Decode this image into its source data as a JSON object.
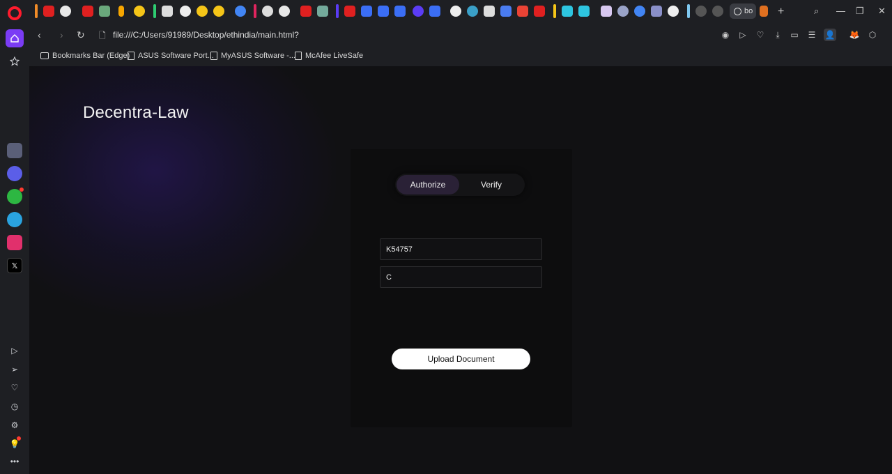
{
  "browser": {
    "active_tab_title": "bo",
    "url": "file:///C:/Users/91989/Desktop/ethindia/main.html?",
    "window_controls": [
      "search-icon",
      "minimize-icon",
      "restore-icon",
      "close-icon"
    ]
  },
  "bookmarks": [
    {
      "label": "Bookmarks Bar (Edge)",
      "icon": "folder-icon"
    },
    {
      "label": "ASUS Software Port...",
      "icon": "page-icon"
    },
    {
      "label": "MyASUS Software -...",
      "icon": "page-icon"
    },
    {
      "label": "McAfee LiveSafe",
      "icon": "page-icon"
    }
  ],
  "sidebar": {
    "apps": [
      "aria-icon",
      "messenger-icon",
      "whatsapp-icon",
      "telegram-icon",
      "instagram-icon",
      "x-icon"
    ],
    "bottom": [
      "player-icon",
      "send-icon",
      "heart-icon",
      "history-icon",
      "settings-icon",
      "lightbulb-icon",
      "more-icon"
    ]
  },
  "app": {
    "brand": "Decentra-Law",
    "tabs": [
      {
        "label": "Authorize",
        "active": true
      },
      {
        "label": "Verify",
        "active": false
      }
    ],
    "fields": [
      {
        "value": "K54757"
      },
      {
        "value": "C"
      }
    ],
    "upload_label": "Upload Document"
  },
  "colors": {
    "accent": "#7b3cf5",
    "page_bg": "#111113",
    "card_bg": "#0d0d0e",
    "active_tab_bg": "#2a2136"
  }
}
